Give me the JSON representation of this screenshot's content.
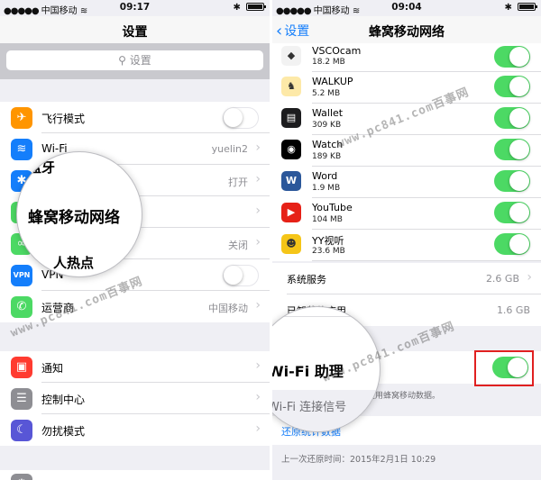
{
  "left": {
    "status": {
      "carrier": "中国移动",
      "time": "09:17"
    },
    "nav_title": "设置",
    "search_placeholder": "设置",
    "rows": [
      {
        "label": "飞行模式",
        "icon": "airplane-icon",
        "toggle": "off"
      },
      {
        "label": "Wi-Fi",
        "icon": "wifi-icon",
        "value": "yuelin2"
      },
      {
        "label": "蓝牙",
        "icon": "bluetooth-icon",
        "value": "打开"
      },
      {
        "label": "蜂窝移动网络",
        "icon": "cellular-icon"
      },
      {
        "label": "个人热点",
        "icon": "hotspot-icon",
        "value": "关闭"
      },
      {
        "label": "VPN",
        "icon": "vpn-icon",
        "toggle": "off"
      },
      {
        "label": "运营商",
        "icon": "phone-icon",
        "value": "中国移动"
      },
      {
        "label": "通知",
        "icon": "notifications-icon"
      },
      {
        "label": "控制中心",
        "icon": "control-center-icon"
      },
      {
        "label": "勿扰模式",
        "icon": "moon-icon"
      }
    ],
    "magnifier": {
      "top_fragment": "蓝牙",
      "main_text": "蜂窝移动网络",
      "bottom_fragment": "人热点"
    },
    "watermark": "www.pc841.com百事网"
  },
  "right": {
    "status": {
      "carrier": "中国移动",
      "time": "09:04"
    },
    "back_label": "设置",
    "nav_title": "蜂窝移动网络",
    "apps": [
      {
        "name": "VSCOcam",
        "size": "18.2 MB",
        "icon": "vscocam-icon"
      },
      {
        "name": "WALKUP",
        "size": "5.2 MB",
        "icon": "walkup-icon"
      },
      {
        "name": "Wallet",
        "size": "309 KB",
        "icon": "wallet-icon"
      },
      {
        "name": "Watch",
        "size": "189 KB",
        "icon": "watch-icon"
      },
      {
        "name": "Word",
        "size": "1.9 MB",
        "icon": "word-icon"
      },
      {
        "name": "YouTube",
        "size": "104 MB",
        "icon": "youtube-icon"
      },
      {
        "name": "YY视听",
        "size": "23.6 MB",
        "icon": "yy-icon"
      }
    ],
    "system_services": {
      "label": "系统服务",
      "value": "2.6 GB"
    },
    "uninstalled": {
      "label": "已卸载的应用",
      "value": "1.6 GB"
    },
    "wifi_assist": {
      "label": "Wi-Fi 助理",
      "toggle": "on",
      "description": "动使用蜂窝移动数据。",
      "secondary": "Wi-Fi 连接信号"
    },
    "reset_stats": "还原统计数据",
    "last_reset": "上一次还原时间：2015年2月1日 10:29",
    "watermarks": [
      "www.pc841.com百事网",
      "www.pc841.com百事网"
    ],
    "colors": {
      "toggle_on": "#4cd964",
      "link": "#147efb",
      "highlight": "#e02020"
    }
  }
}
